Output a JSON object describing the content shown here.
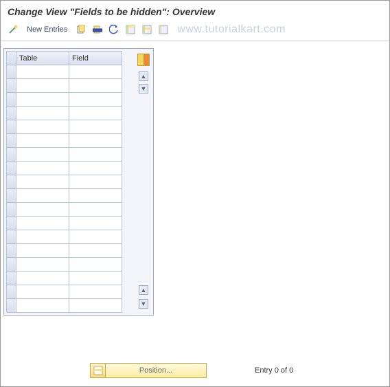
{
  "title": "Change View \"Fields to be hidden\": Overview",
  "toolbar": {
    "new_entries_label": "New Entries"
  },
  "watermark": "www.tutorialkart.com",
  "table": {
    "columns": {
      "c1": "Table",
      "c2": "Field"
    },
    "row_count": 18
  },
  "footer": {
    "position_label": "Position...",
    "entry_text": "Entry 0 of 0"
  }
}
